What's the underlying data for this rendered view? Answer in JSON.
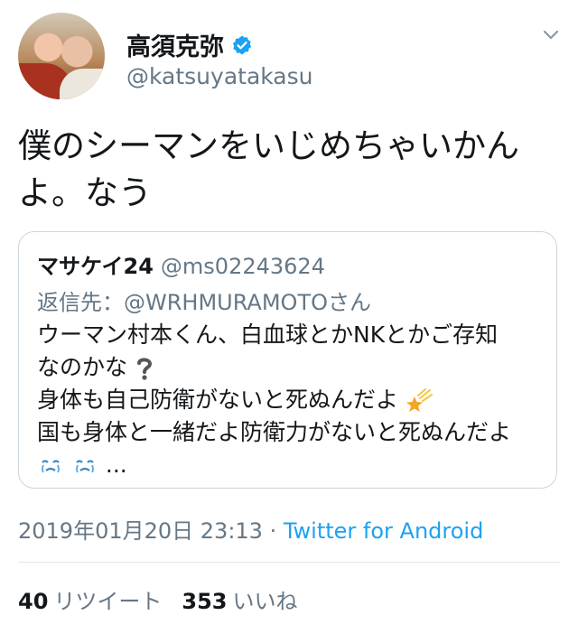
{
  "author": {
    "name": "高須克弥",
    "handle": "@katsuyatakasu"
  },
  "tweet": {
    "line1": "僕のシーマンをいじめちゃいかん",
    "line2": "よ。なう"
  },
  "quoted": {
    "name": "マサケイ24",
    "handle": "@ms02243624",
    "reply_prefix": "返信先：",
    "reply_to": "@WRHMURAMOTO",
    "reply_suffix": "さん",
    "lines": [
      "ウーマン村本くん、白血球とかNKとかご存知",
      "なのかな",
      "身体も自己防衛がないと死ぬんだよ",
      "国も身体と一緒だよ防衛力がないと死ぬんだよ",
      "..."
    ]
  },
  "meta": {
    "timestamp": "2019年01月20日 23:13",
    "separator": " · ",
    "source": "Twitter for Android"
  },
  "stats": {
    "retweets": "40",
    "retweets_label": "リツイート",
    "likes": "353",
    "likes_label": "いいね"
  },
  "colors": {
    "accent": "#1da1f2",
    "muted": "#657786",
    "border": "#ccd6dd"
  }
}
